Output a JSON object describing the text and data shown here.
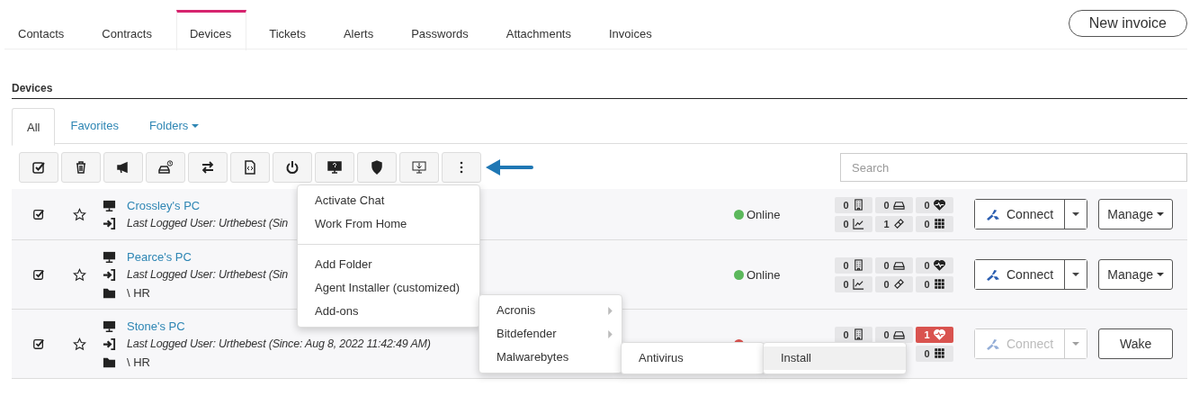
{
  "tabs": [
    {
      "label": "Contacts",
      "selected": false
    },
    {
      "label": "Contracts",
      "selected": false
    },
    {
      "label": "Devices",
      "selected": true
    },
    {
      "label": "Tickets",
      "selected": false
    },
    {
      "label": "Alerts",
      "selected": false
    },
    {
      "label": "Passwords",
      "selected": false
    },
    {
      "label": "Attachments",
      "selected": false
    },
    {
      "label": "Invoices",
      "selected": false
    }
  ],
  "new_invoice_button": "New invoice",
  "section_title": "Devices",
  "subtabs": [
    {
      "label": "All",
      "selected": true,
      "kind": "plain"
    },
    {
      "label": "Favorites",
      "selected": false,
      "kind": "plain"
    },
    {
      "label": "Folders",
      "selected": false,
      "kind": "dropdown"
    }
  ],
  "toolbar": [
    {
      "kind": "check"
    },
    {
      "kind": "trash"
    },
    {
      "kind": "megaphone"
    },
    {
      "kind": "disk-clock"
    },
    {
      "kind": "swap"
    },
    {
      "kind": "script"
    },
    {
      "kind": "power"
    },
    {
      "kind": "monitor-help"
    },
    {
      "kind": "shield"
    },
    {
      "kind": "download"
    },
    {
      "kind": "more"
    }
  ],
  "search": {
    "placeholder": "Search"
  },
  "devices": [
    {
      "name": "Crossley's PC",
      "last_user": "Last Logged User: Urthebest (Sin",
      "status": {
        "label": "Online",
        "color": "#5cb85c"
      },
      "counters": [
        {
          "kind": "ram",
          "value": "0",
          "alert": false
        },
        {
          "kind": "disk",
          "value": "0",
          "alert": false
        },
        {
          "kind": "health",
          "value": "0",
          "alert": false
        },
        {
          "kind": "perf",
          "value": "0",
          "alert": false
        },
        {
          "kind": "patch",
          "value": "1",
          "alert": false
        },
        {
          "kind": "apps",
          "value": "0",
          "alert": false
        }
      ],
      "connect": {
        "label": "Connect",
        "disabled": false
      },
      "action": {
        "label": "Manage",
        "kind": "dropdown"
      }
    },
    {
      "name": "Pearce's PC",
      "last_user": "Last Logged User: Urthebest (Sin",
      "folder": "\\ HR",
      "status": {
        "label": "Online",
        "color": "#5cb85c"
      },
      "counters": [
        {
          "kind": "ram",
          "value": "0",
          "alert": false
        },
        {
          "kind": "disk",
          "value": "0",
          "alert": false
        },
        {
          "kind": "health",
          "value": "0",
          "alert": false
        },
        {
          "kind": "perf",
          "value": "0",
          "alert": false
        },
        {
          "kind": "patch",
          "value": "0",
          "alert": false
        },
        {
          "kind": "apps",
          "value": "0",
          "alert": false
        }
      ],
      "connect": {
        "label": "Connect",
        "disabled": false
      },
      "action": {
        "label": "Manage",
        "kind": "dropdown"
      }
    },
    {
      "name": "Stone's PC",
      "last_user": "Last Logged User: Urthebest (Since: Aug 8, 2022 11:42:49 AM)",
      "folder": "\\ HR",
      "status": {
        "color": "#d9534f"
      },
      "counters": [
        {
          "kind": "ram",
          "value": "0",
          "alert": false
        },
        {
          "kind": "disk",
          "value": "0",
          "alert": false
        },
        {
          "kind": "health",
          "value": "1",
          "alert": true
        },
        {
          "kind": "apps",
          "value": "0",
          "alert": false
        }
      ],
      "connect": {
        "label": "Connect",
        "disabled": true
      },
      "action": {
        "label": "Wake",
        "kind": "plain"
      }
    }
  ],
  "menu": {
    "groups": [
      [
        "Activate Chat",
        "Work From Home"
      ],
      [
        "Add Folder",
        "Agent Installer (customized)",
        "Add-ons"
      ]
    ]
  },
  "addons_menu": [
    {
      "label": "Acronis",
      "has_submenu": true
    },
    {
      "label": "Bitdefender",
      "has_submenu": true
    },
    {
      "label": "Malwarebytes",
      "has_submenu": false
    }
  ],
  "vendor_menu": [
    {
      "label": "Antivirus"
    }
  ],
  "action_menu": [
    {
      "label": "Install",
      "selected": true
    }
  ]
}
